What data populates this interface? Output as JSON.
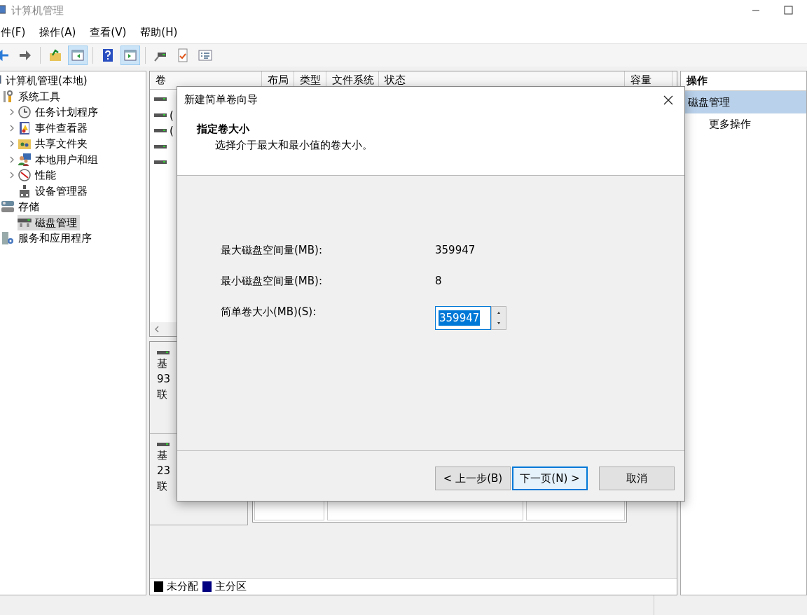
{
  "window": {
    "title": "计算机管理"
  },
  "menu": [
    "件(F)",
    "操作(A)",
    "查看(V)",
    "帮助(H)"
  ],
  "toolbar": [
    {
      "kind": "back",
      "selected": false
    },
    {
      "kind": "forward",
      "selected": false
    },
    {
      "kind": "separator"
    },
    {
      "kind": "up",
      "selected": false
    },
    {
      "kind": "console-tree",
      "selected": true
    },
    {
      "kind": "separator"
    },
    {
      "kind": "help",
      "selected": false
    },
    {
      "kind": "action-pane",
      "selected": true
    },
    {
      "kind": "separator"
    },
    {
      "kind": "connect",
      "selected": false
    },
    {
      "kind": "check",
      "selected": false
    },
    {
      "kind": "list",
      "selected": false
    }
  ],
  "tree": [
    {
      "label": "计算机管理(本地)",
      "kind": "computer",
      "selected": false,
      "children": [
        {
          "label": "系统工具",
          "kind": "tools",
          "selected": false,
          "children": [
            {
              "label": "任务计划程序",
              "kind": "clock",
              "selected": false,
              "expanded": false
            },
            {
              "label": "事件查看器",
              "kind": "event",
              "selected": false,
              "expanded": false
            },
            {
              "label": "共享文件夹",
              "kind": "share",
              "selected": false,
              "expanded": false
            },
            {
              "label": "本地用户和组",
              "kind": "users",
              "selected": false,
              "expanded": false
            },
            {
              "label": "性能",
              "kind": "perf",
              "selected": false,
              "expanded": false
            },
            {
              "label": "设备管理器",
              "kind": "device",
              "selected": false
            }
          ]
        },
        {
          "label": "存储",
          "kind": "storage",
          "selected": false,
          "children": [
            {
              "label": "磁盘管理",
              "kind": "disk",
              "selected": true
            }
          ]
        },
        {
          "label": "服务和应用程序",
          "kind": "services",
          "selected": false
        }
      ]
    }
  ],
  "volumes": {
    "columns": [
      "卷",
      "布局",
      "类型",
      "文件系统",
      "状态",
      "容量"
    ],
    "rows": [
      {
        "kind": "volume"
      },
      {
        "kind": "volume",
        "name": "("
      },
      {
        "kind": "volume",
        "name": "("
      },
      {
        "kind": "volume"
      },
      {
        "kind": "volume"
      }
    ]
  },
  "disks": [
    {
      "lines": [
        "基",
        "93",
        "联"
      ]
    },
    {
      "lines": [
        "基",
        "23",
        "联"
      ]
    }
  ],
  "legend": [
    {
      "label": "未分配",
      "color": "#000000"
    },
    {
      "label": "主分区",
      "color": "#000080"
    }
  ],
  "actions": {
    "title": "操作",
    "items": [
      {
        "kind": "header",
        "label": "磁盘管理"
      },
      {
        "kind": "item",
        "label": "更多操作"
      }
    ]
  },
  "dialog": {
    "title": "新建简单卷向导",
    "heading": "指定卷大小",
    "subtitle": "选择介于最大和最小值的卷大小。",
    "fields": [
      {
        "kind": "readout",
        "label": "最大磁盘空间量(MB):",
        "value": "359947"
      },
      {
        "kind": "readout",
        "label": "最小磁盘空间量(MB):",
        "value": "8"
      },
      {
        "kind": "spin",
        "label": "简单卷大小(MB)(S):",
        "value": "359947",
        "selected": true
      }
    ],
    "buttons": [
      {
        "label": "< 上一步(B)",
        "default": false
      },
      {
        "label": "下一页(N) >",
        "default": true
      },
      {
        "label": "取消",
        "default": false
      }
    ]
  }
}
